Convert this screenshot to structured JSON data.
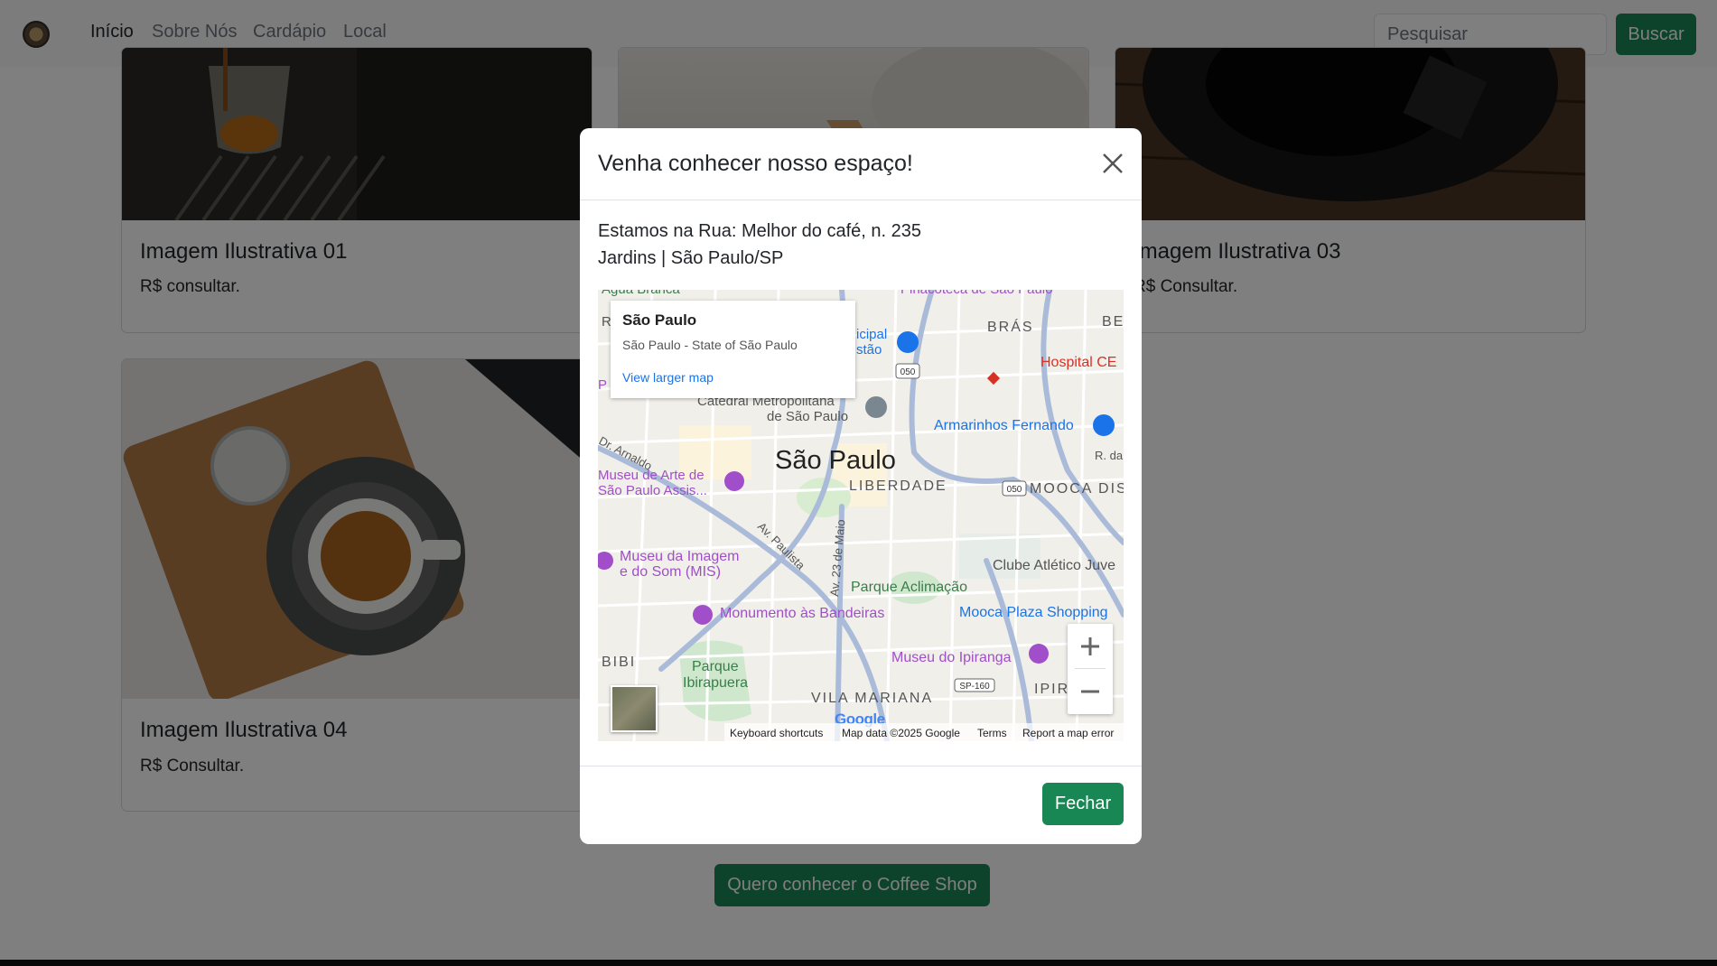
{
  "nav": {
    "links": [
      "Início",
      "Sobre Nós",
      "Cardápio",
      "Local"
    ],
    "search_placeholder": "Pesquisar",
    "search_button": "Buscar"
  },
  "cards": [
    {
      "title": "Imagem Ilustrativa 01",
      "price": "R$ consultar."
    },
    {
      "title": "Imagem Ilustrativa 03",
      "price": "R$ Consultar."
    },
    {
      "title": "Imagem Ilustrativa 04",
      "price": "R$ Consultar."
    }
  ],
  "cta_button": "Quero conhecer o Coffee Shop",
  "modal": {
    "title": "Venha conhecer nosso espaço!",
    "address_line1": "Estamos na Rua: Melhor do café, n. 235",
    "address_line2": "Jardins | São Paulo/SP",
    "close_button": "Fechar"
  },
  "map": {
    "info_title": "São Paulo",
    "info_subtitle": "São Paulo - State of São Paulo",
    "info_link": "View larger map",
    "city_label": "São Paulo",
    "labels": {
      "bras": "BRÁS",
      "be": "BE",
      "liberdade": "LIBERDADE",
      "mooca": "MOOCA DIS",
      "vila_mariana": "VILA MARIANA",
      "bibi": "BIBI",
      "ipir": "IPIR",
      "hospital": "Hospital CE",
      "armarinhos": "Armarinhos Fernando",
      "catedral1": "Catedral Metropolitana",
      "catedral2": "de São Paulo",
      "museu_arte1": "Museu de Arte de",
      "museu_arte2": "São Paulo Assis...",
      "museu_imagem1": "Museu da Imagem",
      "museu_imagem2": "e do Som (MIS)",
      "monumento": "Monumento às Bandeiras",
      "parque_aclimacao": "Parque Aclimação",
      "parque_ibirapuera1": "Parque",
      "parque_ibirapuera2": "Ibirapuera",
      "clube": "Clube Atlético Juve",
      "mooca_plaza": "Mooca Plaza Shopping",
      "museu_ipiranga": "Museu do Ipiranga",
      "dr_arnaldo": "Dr. Arnaldo",
      "av_paulista": "Av. Paulista",
      "av_23_maio": "Av. 23 de Maio",
      "agua_branca": "Agua Branca",
      "pinacoteca": "Pinacoteca de São Paulo",
      "municipal1": "icipal",
      "municipal2": "stão",
      "r_da": "R. da",
      "rl": "RL",
      "pf": "P",
      "sp160": "SP-160",
      "r050a": "050",
      "r050b": "050"
    },
    "attribution": {
      "shortcuts": "Keyboard shortcuts",
      "data": "Map data ©2025 Google",
      "terms": "Terms",
      "report": "Report a map error"
    },
    "google_logo": "Google"
  }
}
